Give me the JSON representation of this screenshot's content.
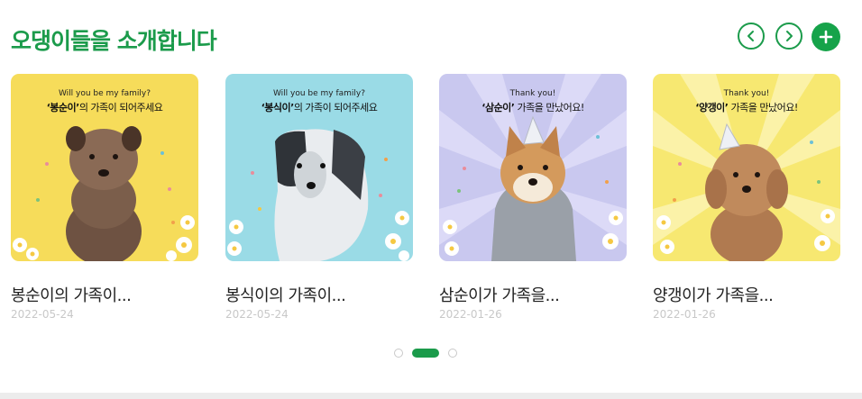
{
  "section": {
    "title": "오댕이들을 소개합니다"
  },
  "controls": {
    "prev_icon": "chevron-left-icon",
    "next_icon": "chevron-right-icon",
    "add_icon": "plus-icon",
    "accent": "#1b9b4b"
  },
  "cards": [
    {
      "title": "봉순이의 가족이...",
      "date": "2022-05-24",
      "poster_top": "Will you be my family?",
      "poster_name": "‘봉순이’",
      "poster_rest": "의 가족이 되어주세요",
      "bg_color": "#f6dc5a"
    },
    {
      "title": "봉식이의 가족이...",
      "date": "2022-05-24",
      "poster_top": "Will you be my family?",
      "poster_name": "‘봉식이’",
      "poster_rest": "의 가족이 되어주세요",
      "bg_color": "#9adbe6"
    },
    {
      "title": "삼순이가 가족을...",
      "date": "2022-01-26",
      "poster_top": "Thank you!",
      "poster_name": "‘삼순이’",
      "poster_rest": " 가족을 만났어요!",
      "bg_color": "#c9c8ef"
    },
    {
      "title": "양갱이가 가족을...",
      "date": "2022-01-26",
      "poster_top": "Thank you!",
      "poster_name": "‘양갱이’",
      "poster_rest": " 가족을 만났어요!",
      "bg_color": "#f7e871"
    }
  ],
  "pagination": {
    "total": 3,
    "active": 2
  }
}
